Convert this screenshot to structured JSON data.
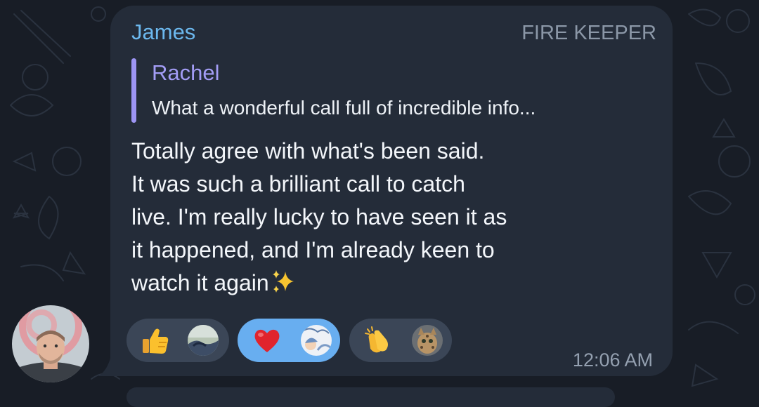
{
  "message": {
    "sender_name": "James",
    "sender_title": "FIRE KEEPER",
    "reply": {
      "name": "Rachel",
      "preview": "What a wonderful call full of incredible info..."
    },
    "lines": [
      "Totally agree with what's been said.",
      "It was such a brilliant call to catch",
      "live. I'm really lucky to have seen it as",
      "it happened, and I'm already keen to",
      "watch it again"
    ],
    "trailing_emoji": "sparkles-icon",
    "time": "12:06 AM"
  },
  "reactions": [
    {
      "emoji": "thumbs-up-icon",
      "reactor": "reactor-avatar-landscape",
      "selected": false
    },
    {
      "emoji": "red-heart-icon",
      "reactor": "reactor-avatar-illustration",
      "selected": true
    },
    {
      "emoji": "clapping-hands-icon",
      "reactor": "reactor-avatar-cat",
      "selected": false
    }
  ],
  "colors": {
    "background": "#181d26",
    "bubble": "#242c39",
    "sender_name": "#6cb8ee",
    "reply_accent": "#9d95f4",
    "reaction_pill": "#3b4657",
    "reaction_selected": "#68aef0",
    "timestamp": "#94a0b0"
  }
}
